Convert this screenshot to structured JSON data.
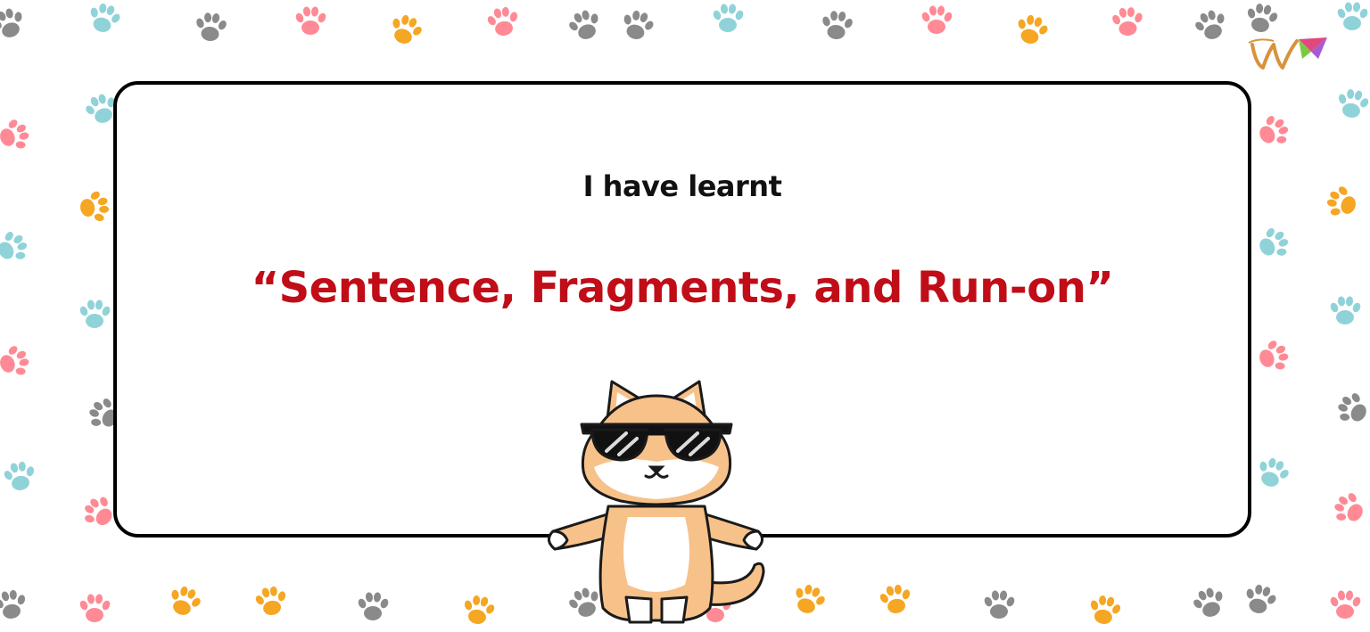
{
  "lesson": {
    "subtitle": "I have learnt",
    "title": "“Sentence, Fragments, and Run-on”"
  },
  "colors": {
    "title": "#c00d17",
    "subtitle": "#111111",
    "card_border": "#000000",
    "paw_blue": "#8fd3d9",
    "paw_pink": "#ff8a95",
    "paw_orange": "#f5a623",
    "paw_gray": "#8a8a8a",
    "cat_fur": "#f7c18a"
  },
  "icons": {
    "background": "paw-print-icon",
    "logo": "brand-logo-icon",
    "mascot": "cat-with-sunglasses-icon"
  }
}
